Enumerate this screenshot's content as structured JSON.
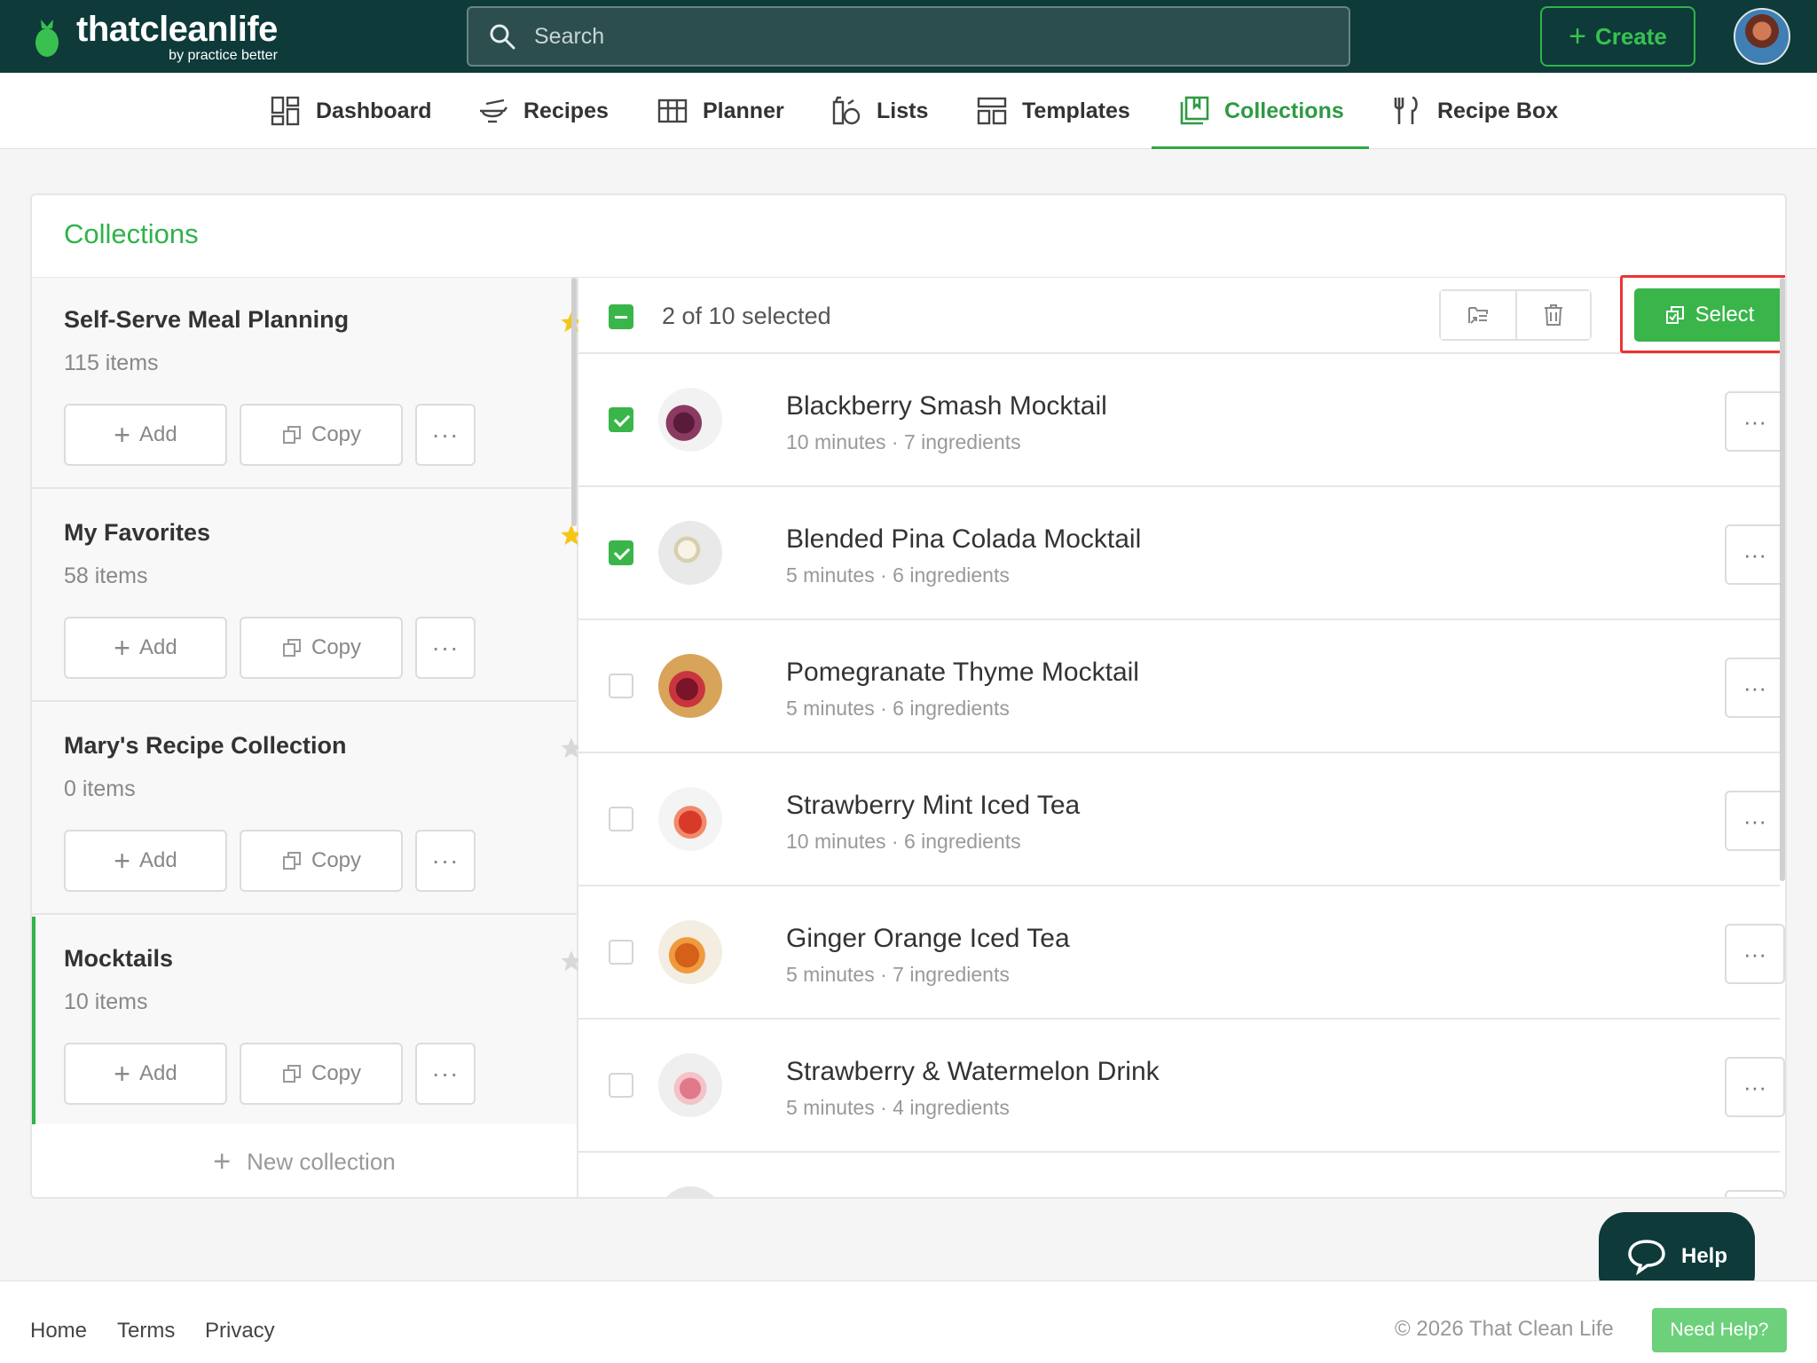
{
  "brand": {
    "name": "thatcleanlife",
    "sub": "by practice better"
  },
  "header": {
    "search_placeholder": "Search",
    "create_label": "Create"
  },
  "nav": [
    {
      "label": "Dashboard",
      "icon": "dashboard-icon"
    },
    {
      "label": "Recipes",
      "icon": "recipes-icon"
    },
    {
      "label": "Planner",
      "icon": "planner-icon"
    },
    {
      "label": "Lists",
      "icon": "lists-icon"
    },
    {
      "label": "Templates",
      "icon": "templates-icon"
    },
    {
      "label": "Collections",
      "icon": "collections-icon",
      "active": true
    },
    {
      "label": "Recipe Box",
      "icon": "recipe-box-icon"
    }
  ],
  "page": {
    "title": "Collections"
  },
  "collections": [
    {
      "name": "Self-Serve Meal Planning",
      "count": "115 items",
      "starred": true
    },
    {
      "name": "My Favorites",
      "count": "58 items",
      "starred": true
    },
    {
      "name": "Mary's Recipe Collection",
      "count": "0 items",
      "starred": false
    },
    {
      "name": "Mocktails",
      "count": "10 items",
      "starred": false,
      "active": true
    }
  ],
  "collection_actions": {
    "add": "Add",
    "copy": "Copy",
    "more": "···"
  },
  "new_collection_label": "New collection",
  "toolbar": {
    "selected_text": "2 of 10 selected",
    "select_label": "Select"
  },
  "recipes": [
    {
      "name": "Blackberry Smash Mocktail",
      "meta": "10 minutes · 7 ingredients",
      "checked": true
    },
    {
      "name": "Blended Pina Colada Mocktail",
      "meta": "5 minutes · 6 ingredients",
      "checked": true
    },
    {
      "name": "Pomegranate Thyme Mocktail",
      "meta": "5 minutes · 6 ingredients",
      "checked": false
    },
    {
      "name": "Strawberry Mint Iced Tea",
      "meta": "10 minutes · 6 ingredients",
      "checked": false
    },
    {
      "name": "Ginger Orange Iced Tea",
      "meta": "5 minutes · 7 ingredients",
      "checked": false
    },
    {
      "name": "Strawberry & Watermelon Drink",
      "meta": "5 minutes · 4 ingredients",
      "checked": false
    }
  ],
  "help": {
    "label": "Help"
  },
  "footer": {
    "home": "Home",
    "terms": "Terms",
    "privacy": "Privacy",
    "copyright": "© 2026 That Clean Life",
    "need_help": "Need Help?"
  },
  "colors": {
    "brand_dark": "#0e3a3a",
    "accent_green": "#39b54a",
    "star_yellow": "#f5c518"
  }
}
